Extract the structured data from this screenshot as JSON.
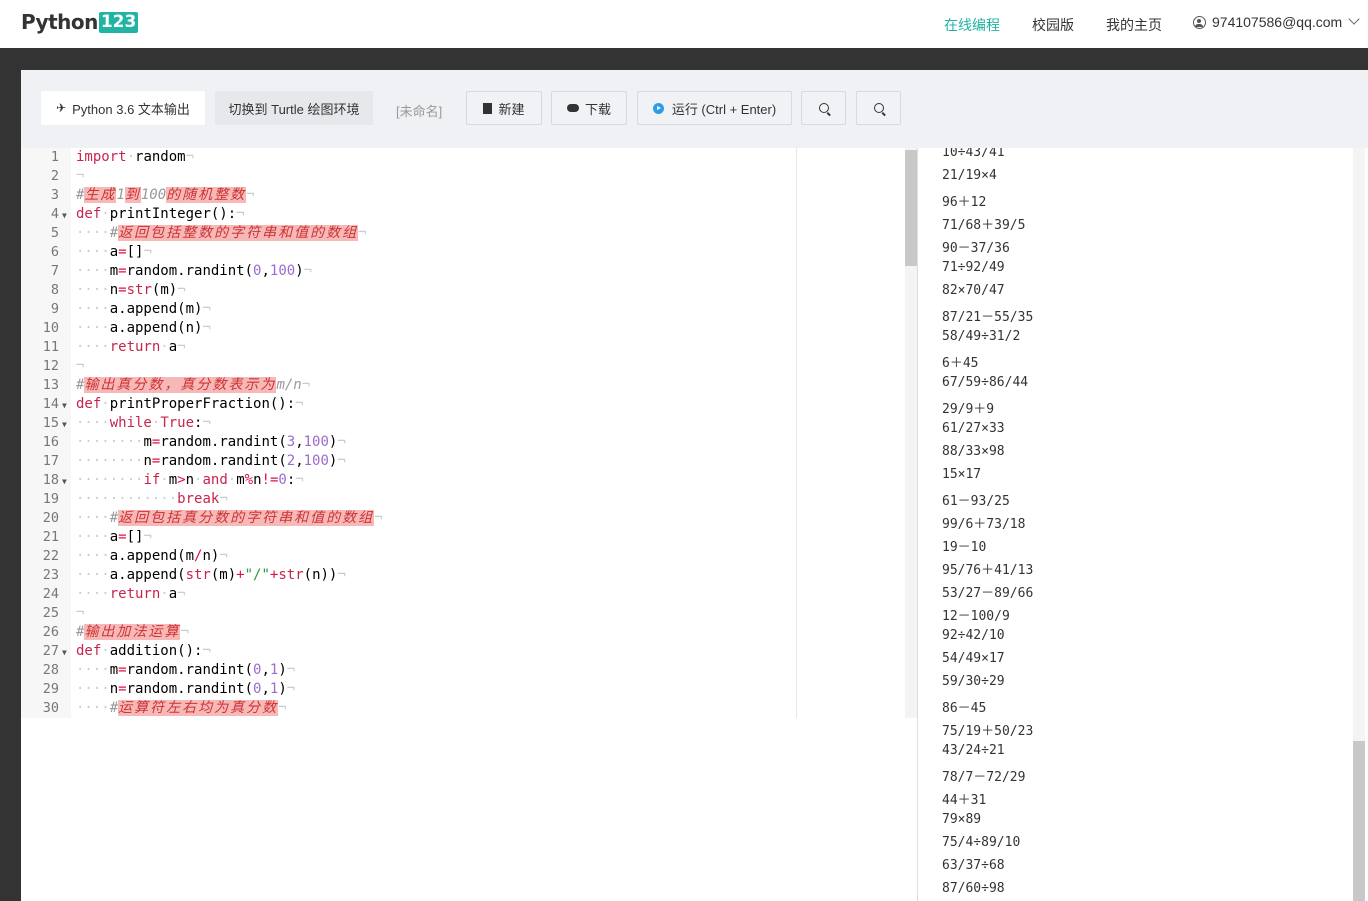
{
  "nav": {
    "logo_text": "Python",
    "logo_badge": "123",
    "links": [
      "在线编程",
      "校园版",
      "我的主页"
    ],
    "user_email": "974107586@qq.com"
  },
  "toolbar": {
    "env_label": "Python 3.6 文本输出",
    "turtle_label": "切换到 Turtle 绘图环境",
    "filename": "[未命名]",
    "new_label": "新建",
    "download_label": "下载",
    "run_label": "运行 (Ctrl + Enter)"
  },
  "code_lines": [
    "import random",
    "",
    "#生成1到100的随机整数",
    "def printInteger():",
    "    #返回包括整数的字符串和值的数组",
    "    a=[]",
    "    m=random.randint(0,100)",
    "    n=str(m)",
    "    a.append(m)",
    "    a.append(n)",
    "    return a",
    "",
    "#输出真分数，真分数表示为m/n",
    "def printProperFraction():",
    "    while True:",
    "        m=random.randint(3,100)",
    "        n=random.randint(2,100)",
    "        if m>n and m%n!=0:",
    "            break",
    "    #返回包括真分数的字符串和值的数组",
    "    a=[]",
    "    a.append(m/n)",
    "    a.append(str(m)+\"/\"+str(n))",
    "    return a",
    "",
    "#输出加法运算",
    "def addition():",
    "    m=random.randint(0,1)",
    "    n=random.randint(0,1)",
    "    #运算符左右均为真分数"
  ],
  "output_lines": [
    "10÷43/41",
    "21/19×4",
    "96＋12",
    "71/68＋39/5",
    "90－37/36",
    "71÷92/49",
    "82×70/47",
    "87/21－55/35",
    "58/49÷31/2",
    "6＋45",
    "67/59÷86/44",
    "29/9＋9",
    "61/27×33",
    "88/33×98",
    "15×17",
    "61－93/25",
    "99/6＋73/18",
    "19－10",
    "95/76＋41/13",
    "53/27－89/66",
    "12－100/9",
    "92÷42/10",
    "54/49×17",
    "59/30÷29",
    "86－45",
    "75/19＋50/23",
    "43/24÷21",
    "78/7－72/29",
    "44＋31",
    "79×89",
    "75/4÷89/10",
    "63/37÷68",
    "87/60÷98"
  ]
}
